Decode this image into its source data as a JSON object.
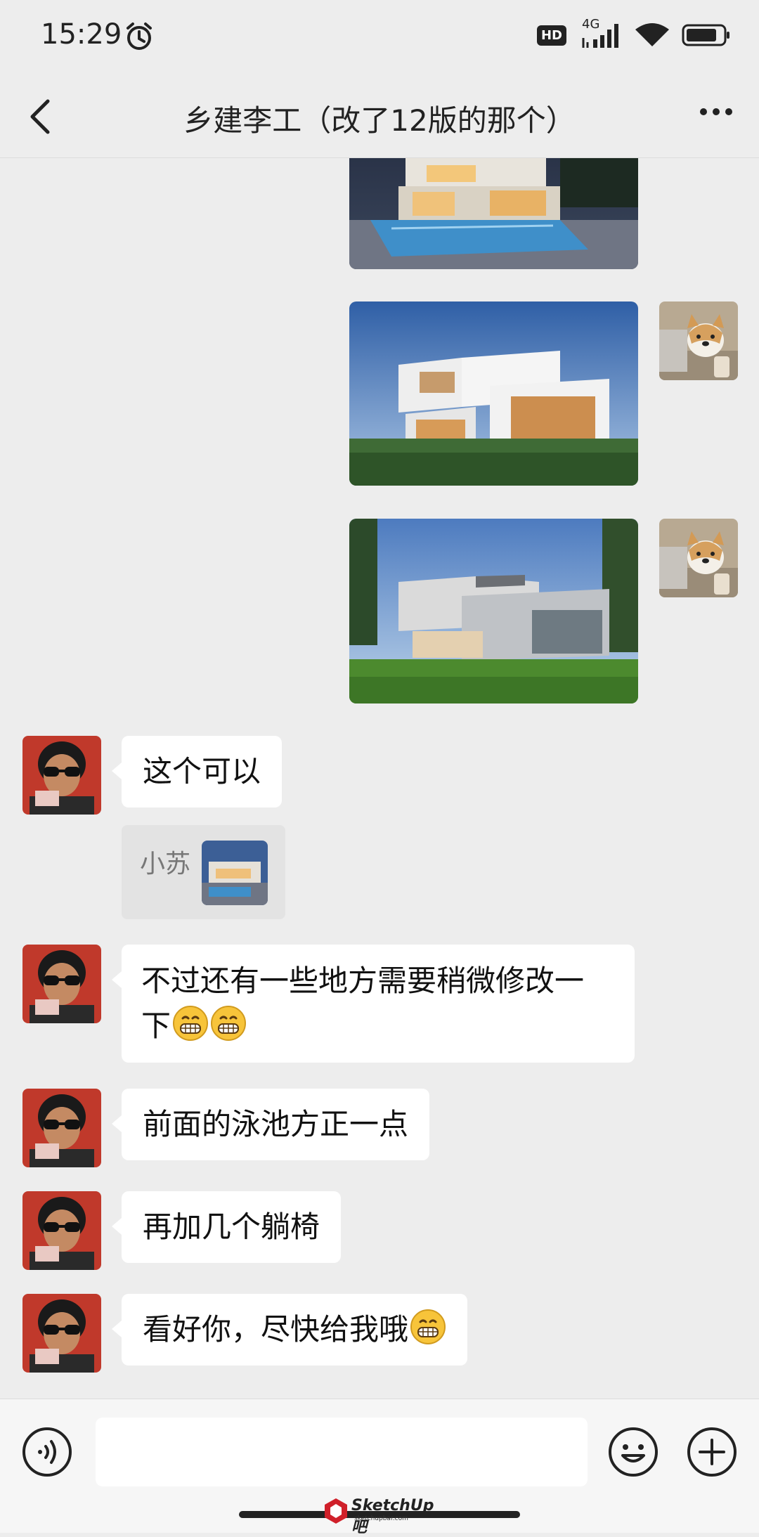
{
  "status": {
    "time": "15:29",
    "hd": "HD",
    "network": "4G"
  },
  "header": {
    "title": "乡建李工（改了12版的那个）"
  },
  "messages": [
    {
      "text": "这个可以"
    },
    {
      "quote_label": "小苏"
    },
    {
      "line1": "不过还有一些地方需要稍微修改一",
      "line2": "下"
    },
    {
      "text": "前面的泳池方正一点"
    },
    {
      "text": "再加几个躺椅"
    },
    {
      "text": "看好你，尽快给我哦"
    }
  ],
  "watermark": {
    "brand": "SketchUp吧",
    "url": "sketchupbar.com"
  },
  "icons": [
    "back-arrow-icon",
    "more-icon",
    "alarm-icon",
    "signal-icon",
    "wifi-icon",
    "battery-icon",
    "voice-icon",
    "emoji-icon",
    "plus-icon",
    "grin-emoji-icon"
  ],
  "colors": {
    "background": "#ededed",
    "bubble": "#ffffff",
    "bar": "#f6f6f6"
  }
}
